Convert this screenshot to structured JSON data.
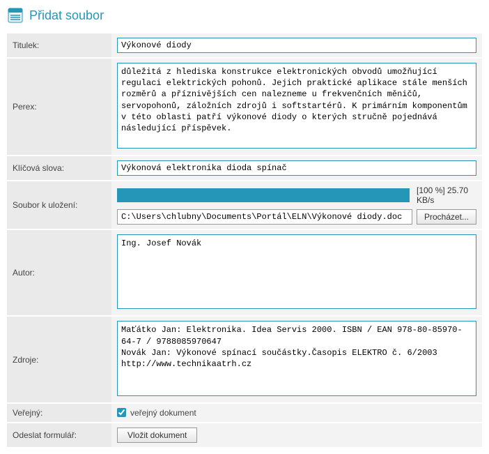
{
  "header": {
    "title": "Přidat soubor"
  },
  "labels": {
    "titulek": "Titulek:",
    "perex": "Perex:",
    "klicova_slova": "Klíčová slova:",
    "soubor": "Soubor k uložení:",
    "autor": "Autor:",
    "zdroje": "Zdroje:",
    "verejny": "Veřejný:",
    "odeslat": "Odeslat formulář:"
  },
  "fields": {
    "titulek": "Výkonové diody",
    "perex": "důležitá z hlediska konstrukce elektronických obvodů umožňující regulaci elektrických pohonů. Jejich praktické aplikace stále menších rozměrů a příznivějších cen nalezneme u frekvenčních měničů, servopohonů, záložních zdrojů i softstartérů. K primárním komponentům v této oblasti patří výkonové diody o kterých stručně pojednává následující příspěvek.",
    "klicova_slova": "Výkonová elektronika dioda spínač",
    "soubor_path": "C:\\Users\\chlubny\\Documents\\Portál\\ELN\\Výkonové diody.doc",
    "autor": "Ing. Josef Novák",
    "zdroje": "Maťátko Jan: Elektronika. Idea Servis 2000. ISBN / EAN 978-80-85970-64-7 / 9788085970647\nNovák Jan: Výkonové spínací součástky.Časopis ELEKTRO č. 6/2003\nhttp://www.technikaatrh.cz",
    "verejny_label": "veřejný dokument"
  },
  "upload": {
    "percent": "[100 %]",
    "speed": "25.70 KB/s"
  },
  "buttons": {
    "browse": "Procházet...",
    "submit": "Vložit dokument"
  }
}
